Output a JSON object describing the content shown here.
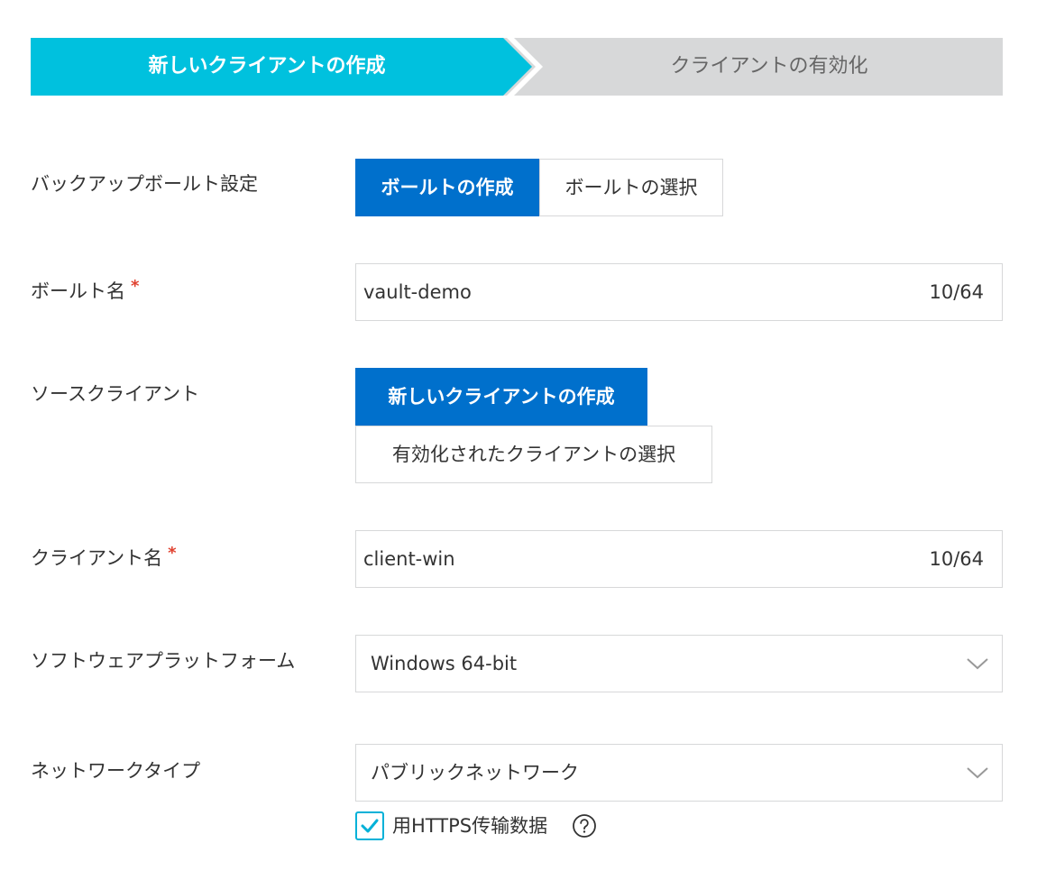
{
  "steps": [
    {
      "label": "新しいクライアントの作成",
      "state": "active"
    },
    {
      "label": "クライアントの有効化",
      "state": "inactive"
    }
  ],
  "colors": {
    "step_active": "#00c1de",
    "step_inactive": "#d7d8d9",
    "button_primary": "#0070cc",
    "required": "#e0412f",
    "checkbox": "#00b1d8",
    "border": "#d7d8d9"
  },
  "vault_setting": {
    "label": "バックアップボールト設定",
    "options": [
      "ボールトの作成",
      "ボールトの選択"
    ],
    "selected": "ボールトの作成"
  },
  "vault_name": {
    "label": "ボールト名",
    "required_mark": "*",
    "value": "vault-demo",
    "counter": "10/64"
  },
  "source_client": {
    "label": "ソースクライアント",
    "options": [
      "新しいクライアントの作成",
      "有効化されたクライアントの選択"
    ],
    "selected": "新しいクライアントの作成"
  },
  "client_name": {
    "label": "クライアント名",
    "required_mark": "*",
    "value": "client-win",
    "counter": "10/64"
  },
  "software_platform": {
    "label": "ソフトウェアプラットフォーム",
    "value": "Windows 64-bit",
    "icon": "chevron-down-icon"
  },
  "network_type": {
    "label": "ネットワークタイプ",
    "value": "パブリックネットワーク",
    "icon": "chevron-down-icon"
  },
  "https_option": {
    "label": "用HTTPS传输数据",
    "checked": true,
    "icon": "help-icon"
  }
}
